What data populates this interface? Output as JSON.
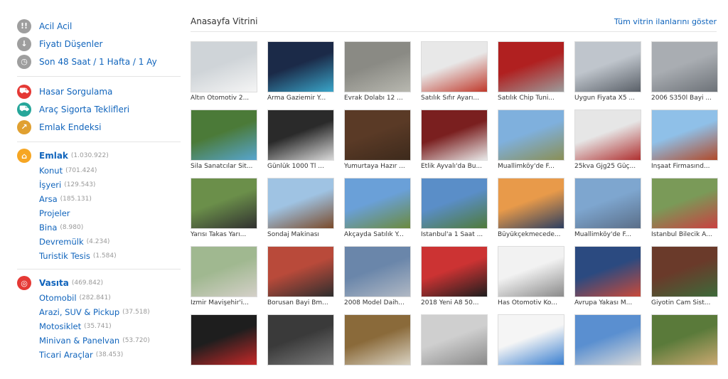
{
  "quick_links": [
    {
      "label": "Acil Acil",
      "icon": "exclamation-icon",
      "glyph": "!!",
      "color": "#9e9e9e"
    },
    {
      "label": "Fiyatı Düşenler",
      "icon": "arrow-down-icon",
      "glyph": "↓",
      "color": "#9e9e9e"
    },
    {
      "label": "Son 48 Saat / 1 Hafta / 1 Ay",
      "icon": "clock-icon",
      "glyph": "◷",
      "color": "#9e9e9e"
    }
  ],
  "tools": [
    {
      "label": "Hasar Sorgulama",
      "icon": "car-damage-icon",
      "glyph": "⛟",
      "color": "#e53935"
    },
    {
      "label": "Araç Sigorta Teklifleri",
      "icon": "car-insurance-icon",
      "glyph": "⛟",
      "color": "#26a69a"
    },
    {
      "label": "Emlak Endeksi",
      "icon": "chart-icon",
      "glyph": "↗",
      "color": "#e0a030"
    }
  ],
  "categories": [
    {
      "label": "Emlak",
      "count": "(1.030.922)",
      "icon": "home-icon",
      "glyph": "⌂",
      "color": "#f6a623",
      "subs": [
        {
          "label": "Konut",
          "count": "(701.424)"
        },
        {
          "label": "İşyeri",
          "count": "(129.543)"
        },
        {
          "label": "Arsa",
          "count": "(185.131)"
        },
        {
          "label": "Projeler",
          "count": ""
        },
        {
          "label": "Bina",
          "count": "(8.980)"
        },
        {
          "label": "Devremülk",
          "count": "(4.234)"
        },
        {
          "label": "Turistik Tesis",
          "count": "(1.584)"
        }
      ]
    },
    {
      "label": "Vasıta",
      "count": "(469.842)",
      "icon": "steering-wheel-icon",
      "glyph": "◎",
      "color": "#e53935",
      "subs": [
        {
          "label": "Otomobil",
          "count": "(282.841)"
        },
        {
          "label": "Arazi, SUV & Pickup",
          "count": "(37.518)"
        },
        {
          "label": "Motosiklet",
          "count": "(35.741)"
        },
        {
          "label": "Minivan & Panelvan",
          "count": "(53.720)"
        },
        {
          "label": "Ticari Araçlar",
          "count": "(38.453)"
        }
      ]
    }
  ],
  "showcase": {
    "title": "Anasayfa Vitrini",
    "all_link": "Tüm vitrin ilanlarını göster",
    "items": [
      {
        "caption": "Altın Otomotiv 2...",
        "colors": [
          "#cfd4d8",
          "#f5f5f5"
        ]
      },
      {
        "caption": "Arma Gaziemir Y...",
        "colors": [
          "#1b2a48",
          "#3aa5c9"
        ]
      },
      {
        "caption": "Evrak Dolabı 12 ...",
        "colors": [
          "#8a8a84",
          "#b8b8b0"
        ]
      },
      {
        "caption": "Satılık Sıfır Ayarı...",
        "colors": [
          "#e8e8e8",
          "#c0392b"
        ]
      },
      {
        "caption": "Satılık Chip Tuni...",
        "colors": [
          "#b02020",
          "#9c9c9c"
        ]
      },
      {
        "caption": "Uygun Fiyata X5 ...",
        "colors": [
          "#bfc5cc",
          "#5a6068"
        ]
      },
      {
        "caption": "2006 S350l Bayi ...",
        "colors": [
          "#a9adb2",
          "#6d7278"
        ]
      },
      {
        "caption": "Sila Sanatcılar Sit...",
        "colors": [
          "#4b7a38",
          "#57a5cf"
        ]
      },
      {
        "caption": "Günlük 1000 Tl ...",
        "colors": [
          "#2a2a2a",
          "#d9d9d9"
        ]
      },
      {
        "caption": "Yumurtaya Hazır ...",
        "colors": [
          "#5a3a26",
          "#3d2a1c"
        ]
      },
      {
        "caption": "Etlik Ayvalı'da Bu...",
        "colors": [
          "#7a1f1f",
          "#e9e9e9"
        ]
      },
      {
        "caption": "Muallimköy'de F...",
        "colors": [
          "#7fb0dd",
          "#8a8f55"
        ]
      },
      {
        "caption": "25kva Gjg25 Güç...",
        "colors": [
          "#e6e6e6",
          "#b03030"
        ]
      },
      {
        "caption": "Inşaat Firmasınd...",
        "colors": [
          "#8fc0e8",
          "#b04a2a"
        ]
      },
      {
        "caption": "Yarısı Takas Yarı...",
        "colors": [
          "#6b8f4a",
          "#303030"
        ]
      },
      {
        "caption": "Sondaj Makinası",
        "colors": [
          "#9fc3e3",
          "#7a4a2a"
        ]
      },
      {
        "caption": "Akçayda Satılık Y...",
        "colors": [
          "#6aa0d8",
          "#6b8a3e"
        ]
      },
      {
        "caption": "Istanbul'a 1 Saat ...",
        "colors": [
          "#5a8ec8",
          "#4f7a3a"
        ]
      },
      {
        "caption": "Büyükçekmecede...",
        "colors": [
          "#e89a4a",
          "#2c3e60"
        ]
      },
      {
        "caption": "Muallimköy'de F...",
        "colors": [
          "#7ea6cf",
          "#5a6e88"
        ]
      },
      {
        "caption": "Istanbul Bilecik A...",
        "colors": [
          "#7a9a58",
          "#c94040"
        ]
      },
      {
        "caption": "Izmir Mavişehir'i...",
        "colors": [
          "#a0b890",
          "#d4d0c8"
        ]
      },
      {
        "caption": "Borusan Bayi Bm...",
        "colors": [
          "#b94a3a",
          "#2e2e2e"
        ]
      },
      {
        "caption": "2008 Model Daih...",
        "colors": [
          "#6a86aa",
          "#b0b8c4"
        ]
      },
      {
        "caption": "2018 Yeni A8 50...",
        "colors": [
          "#c33",
          "#1e1e1e"
        ]
      },
      {
        "caption": "Has Otomotiv Ko...",
        "colors": [
          "#f2f2f2",
          "#8a8a8a"
        ]
      },
      {
        "caption": "Avrupa Yakası M...",
        "colors": [
          "#2b4a80",
          "#c94a3a"
        ]
      },
      {
        "caption": "Giyotin Cam Sist...",
        "colors": [
          "#6a3a2a",
          "#3d6a3a"
        ]
      },
      {
        "caption": "",
        "colors": [
          "#1e1e1e",
          "#c62828"
        ]
      },
      {
        "caption": "",
        "colors": [
          "#3a3a3a",
          "#7a7a7a"
        ]
      },
      {
        "caption": "",
        "colors": [
          "#8a6a3a",
          "#d9d2c2"
        ]
      },
      {
        "caption": "",
        "colors": [
          "#cfcfcf",
          "#8a8a8a"
        ]
      },
      {
        "caption": "",
        "colors": [
          "#f5f5f5",
          "#3a7fd0"
        ]
      },
      {
        "caption": "",
        "colors": [
          "#5a8fd0",
          "#d9d9d9"
        ]
      },
      {
        "caption": "",
        "colors": [
          "#5a7a3a",
          "#c9a870"
        ]
      }
    ]
  }
}
